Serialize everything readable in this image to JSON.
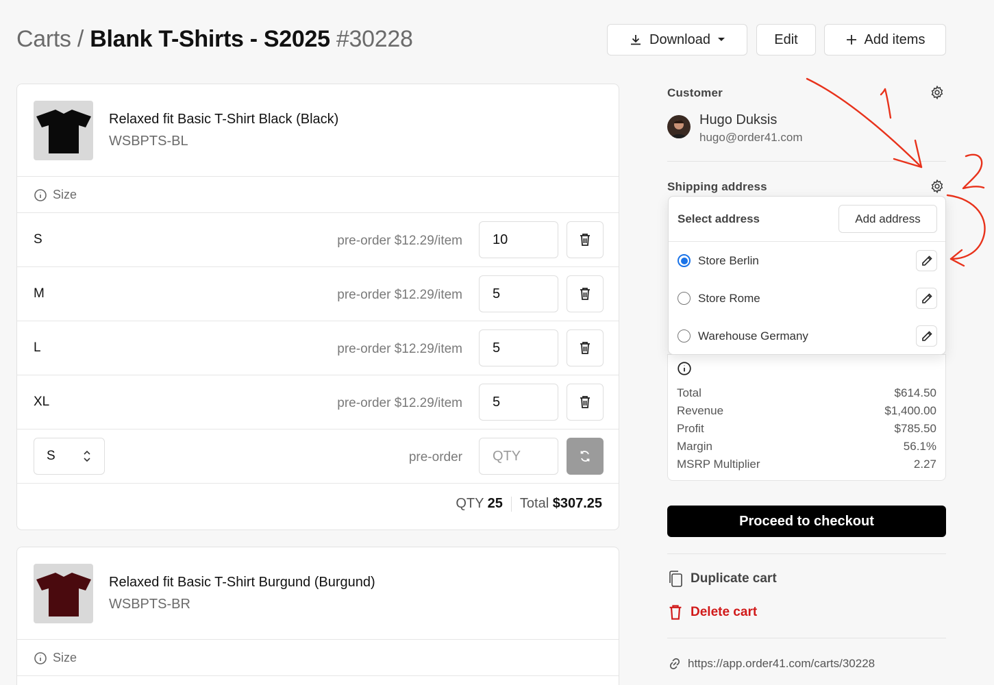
{
  "header": {
    "crumb": "Carts",
    "separator": "/",
    "cart_name": "Blank T-Shirts - S2025",
    "cart_number": "#30228",
    "download_label": "Download",
    "edit_label": "Edit",
    "add_items_label": "Add items"
  },
  "products": [
    {
      "name": "Relaxed fit Basic T-Shirt Black (Black)",
      "sku": "WSBPTS-BL",
      "shirt_color": "#0a0a0a",
      "size_label": "Size",
      "variants": [
        {
          "size": "S",
          "price": "pre-order $12.29/item",
          "qty": "10"
        },
        {
          "size": "M",
          "price": "pre-order $12.29/item",
          "qty": "5"
        },
        {
          "size": "L",
          "price": "pre-order $12.29/item",
          "qty": "5"
        },
        {
          "size": "XL",
          "price": "pre-order $12.29/item",
          "qty": "5"
        }
      ],
      "add_row": {
        "size": "S",
        "price": "pre-order",
        "qty_placeholder": "QTY"
      },
      "qty_label": "QTY",
      "qty_total": "25",
      "total_label": "Total",
      "total_value": "$307.25"
    },
    {
      "name": "Relaxed fit Basic T-Shirt Burgund (Burgund)",
      "sku": "WSBPTS-BR",
      "shirt_color": "#4a0a0e",
      "size_label": "Size"
    }
  ],
  "customer": {
    "label": "Customer",
    "name": "Hugo Duksis",
    "email": "hugo@order41.com"
  },
  "shipping": {
    "label": "Shipping address",
    "popover": {
      "title": "Select address",
      "add_label": "Add address",
      "options": [
        {
          "label": "Store Berlin",
          "selected": true
        },
        {
          "label": "Store Rome",
          "selected": false
        },
        {
          "label": "Warehouse Germany",
          "selected": false
        }
      ]
    }
  },
  "summary": {
    "rows": [
      {
        "label": "Total",
        "value": "$614.50"
      },
      {
        "label": "Revenue",
        "value": "$1,400.00"
      },
      {
        "label": "Profit",
        "value": "$785.50"
      },
      {
        "label": "Margin",
        "value": "56.1%"
      },
      {
        "label": "MSRP Multiplier",
        "value": "2.27"
      }
    ]
  },
  "checkout_label": "Proceed to checkout",
  "duplicate_label": "Duplicate cart",
  "delete_label": "Delete cart",
  "cart_url": "https://app.order41.com/carts/30228",
  "colors": {
    "accent": "#1a73e8",
    "danger": "#d11a1a",
    "annotation": "#e8321b"
  },
  "annotations": {
    "one": "1",
    "two": "2"
  }
}
